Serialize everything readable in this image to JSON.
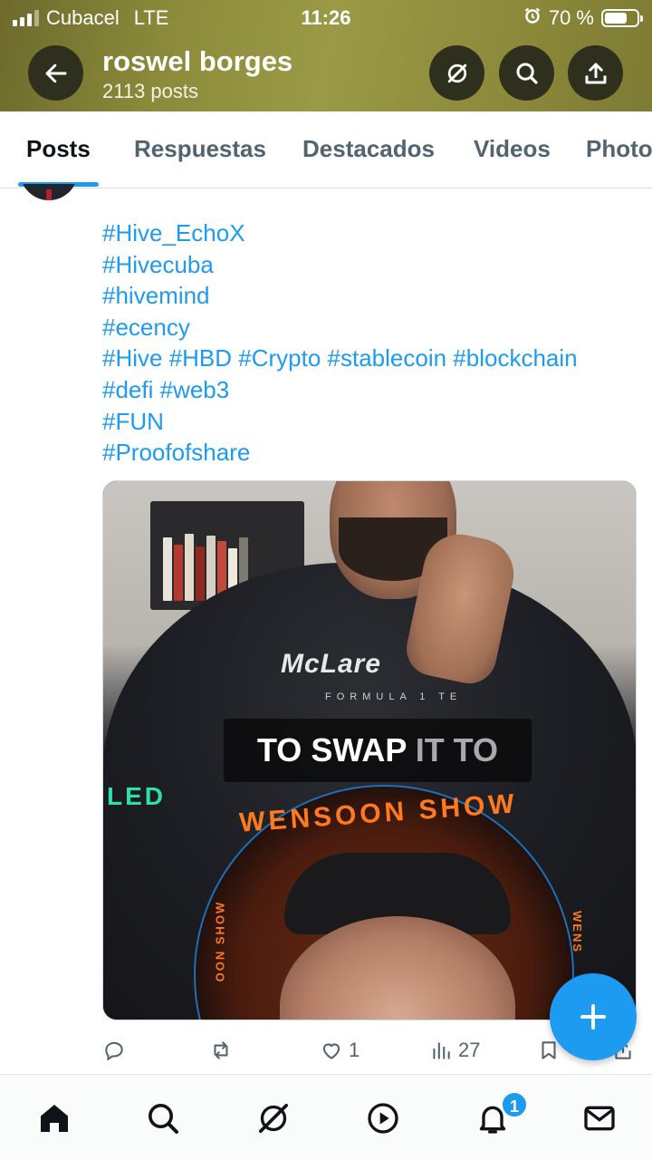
{
  "status_bar": {
    "carrier": "Cubacel",
    "network": "LTE",
    "time": "11:26",
    "battery_percent": "70 %",
    "battery_level": 0.7
  },
  "header": {
    "profile_name": "roswel borges",
    "post_count": "2113 posts",
    "back_icon": "arrow-left-icon",
    "grok_icon": "grok-icon",
    "search_icon": "search-icon",
    "share_icon": "share-icon"
  },
  "tabs": [
    {
      "label": "Posts",
      "active": true
    },
    {
      "label": "Respuestas",
      "active": false
    },
    {
      "label": "Destacados",
      "active": false
    },
    {
      "label": "Videos",
      "active": false
    },
    {
      "label": "Photos",
      "active": false
    }
  ],
  "post": {
    "hashtags": [
      "#Hive_EchoX",
      "#Hivecuba",
      "#hivemind",
      "#ecency",
      "#Hive #HBD #Crypto #stablecoin #blockchain",
      "#defi #web3",
      "#FUN",
      "#Proofofshare"
    ],
    "media": {
      "brand_text": "McLare",
      "brand_sub": "FORMULA 1 TE",
      "caption_bright": "TO SWAP",
      "caption_dim": " IT TO",
      "led_text": "LED",
      "show_text": "WENSOON SHOW",
      "show_left": "OON SHOW",
      "show_right": "WENS"
    },
    "actions": {
      "reply_count": "",
      "repost_count": "",
      "like_count": "1",
      "views_count": "27"
    }
  },
  "fab": {
    "icon": "plus-icon"
  },
  "bottom_nav": {
    "items": [
      "home-icon",
      "search-icon",
      "grok-icon",
      "play-icon",
      "bell-icon",
      "mail-icon"
    ],
    "notification_badge": "1"
  },
  "colors": {
    "accent": "#1d9bf0",
    "header_bg": "#8a8a3a",
    "muted": "#536471"
  }
}
